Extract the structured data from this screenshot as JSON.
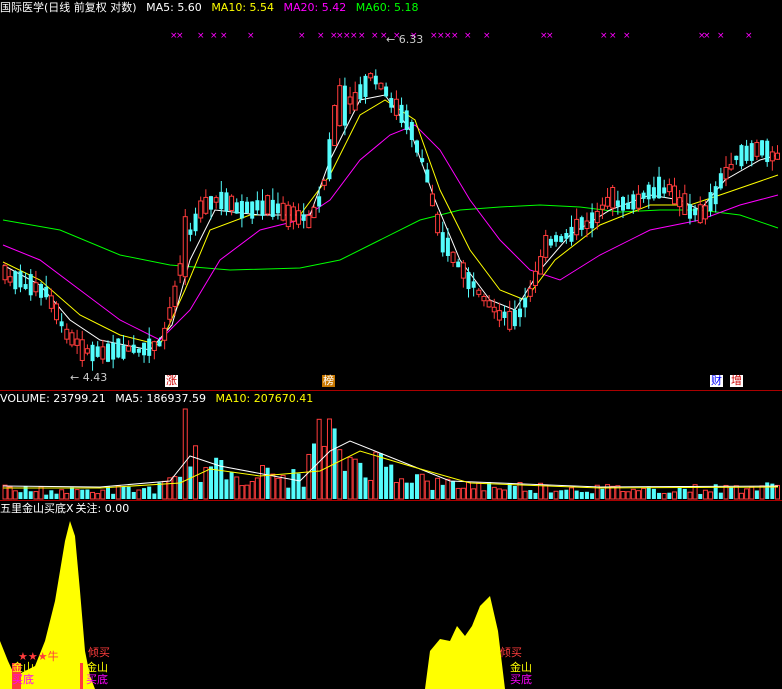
{
  "price_header": {
    "name": "国际医学",
    "mode": "(日线 前复权 对数)",
    "ma5": {
      "label": "MA5:",
      "value": "5.60",
      "color": "#ffffff"
    },
    "ma10": {
      "label": "MA10:",
      "value": "5.54",
      "color": "#ffff00"
    },
    "ma20": {
      "label": "MA20:",
      "value": "5.42",
      "color": "#ff00ff"
    },
    "ma60": {
      "label": "MA60:",
      "value": "5.18",
      "color": "#00ff00"
    }
  },
  "annotations": {
    "high_label": "6.33",
    "low_label": "4.43",
    "event_tags": [
      "涨",
      "榜",
      "财",
      "增"
    ]
  },
  "volume_header": {
    "volume": {
      "label": "VOLUME:",
      "value": "23799.21",
      "color": "#ffffff"
    },
    "ma5": {
      "label": "MA5:",
      "value": "186937.59",
      "color": "#ffffff"
    },
    "ma10": {
      "label": "MA10:",
      "value": "207670.41",
      "color": "#ffff00"
    }
  },
  "indicator_header": {
    "name": "五里金山买底X",
    "focus_label": "关注:",
    "focus_value": "0.00"
  },
  "signals": {
    "stars": "★★★牛",
    "gold_mountain": "金山",
    "buy_bottom": "买底",
    "dump_buy": "倾买"
  },
  "colors": {
    "up": "#ff3c3c",
    "down": "#54fcfc",
    "ma5": "#ffffff",
    "ma10": "#ffff00",
    "ma20": "#ff00ff",
    "ma60": "#00ff00",
    "indicator": "#ffff00",
    "axis": "#aa0000"
  }
}
